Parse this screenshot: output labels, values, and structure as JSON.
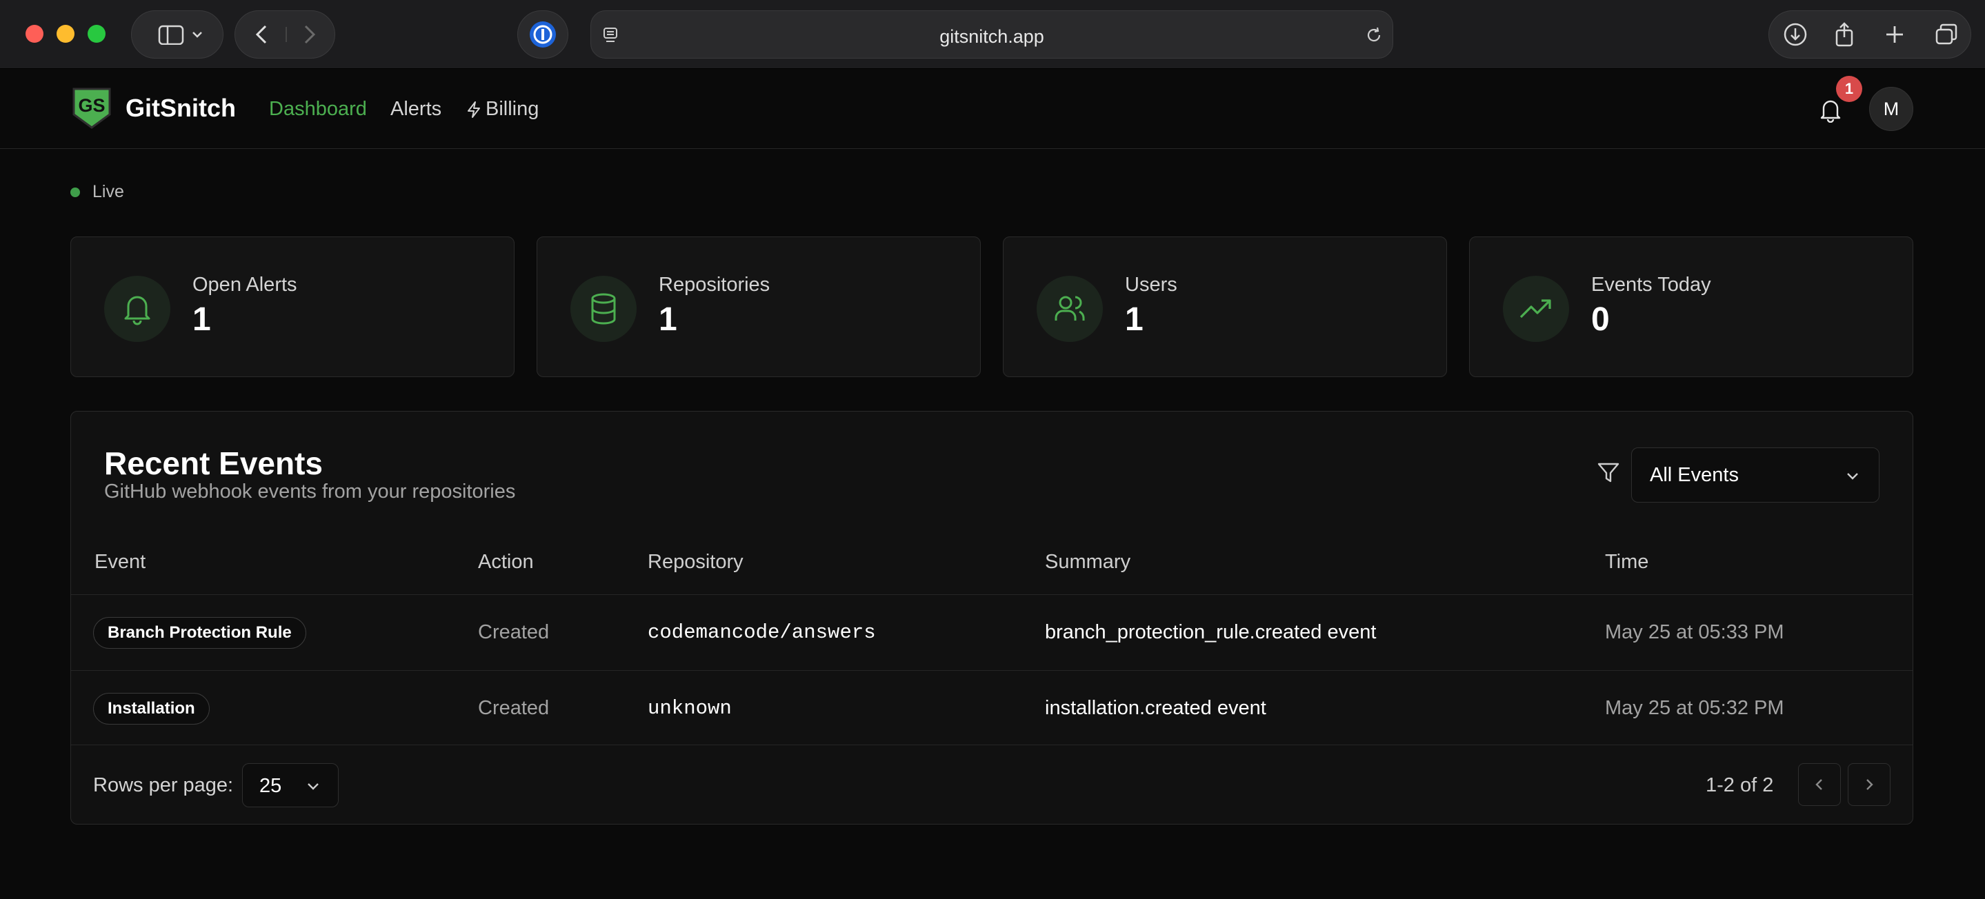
{
  "browser": {
    "url": "gitsnitch.app"
  },
  "header": {
    "brand": "GitSnitch",
    "logo_text": "GS",
    "nav": [
      {
        "label": "Dashboard",
        "active": true
      },
      {
        "label": "Alerts",
        "active": false
      },
      {
        "label": "Billing",
        "active": false
      }
    ],
    "notification_count": "1",
    "avatar_initial": "M"
  },
  "status": {
    "label": "Live"
  },
  "stats": [
    {
      "label": "Open Alerts",
      "value": "1",
      "icon": "bell-icon"
    },
    {
      "label": "Repositories",
      "value": "1",
      "icon": "database-icon"
    },
    {
      "label": "Users",
      "value": "1",
      "icon": "users-icon"
    },
    {
      "label": "Events Today",
      "value": "0",
      "icon": "trending-up-icon"
    }
  ],
  "events": {
    "title": "Recent Events",
    "subtitle": "GitHub webhook events from your repositories",
    "filter_value": "All Events",
    "columns": [
      "Event",
      "Action",
      "Repository",
      "Summary",
      "Time"
    ],
    "rows": [
      {
        "event": "Branch Protection Rule",
        "action": "Created",
        "repository": "codemancode/answers",
        "summary": "branch_protection_rule.created event",
        "time": "May 25 at 05:33 PM"
      },
      {
        "event": "Installation",
        "action": "Created",
        "repository": "unknown",
        "summary": "installation.created event",
        "time": "May 25 at 05:32 PM"
      }
    ],
    "rows_per_page_label": "Rows per page:",
    "rows_per_page_value": "25",
    "page_info": "1-2 of 2"
  },
  "colors": {
    "accent": "#4caf50",
    "badge": "#d84a4a",
    "background": "#0a0a0a"
  }
}
